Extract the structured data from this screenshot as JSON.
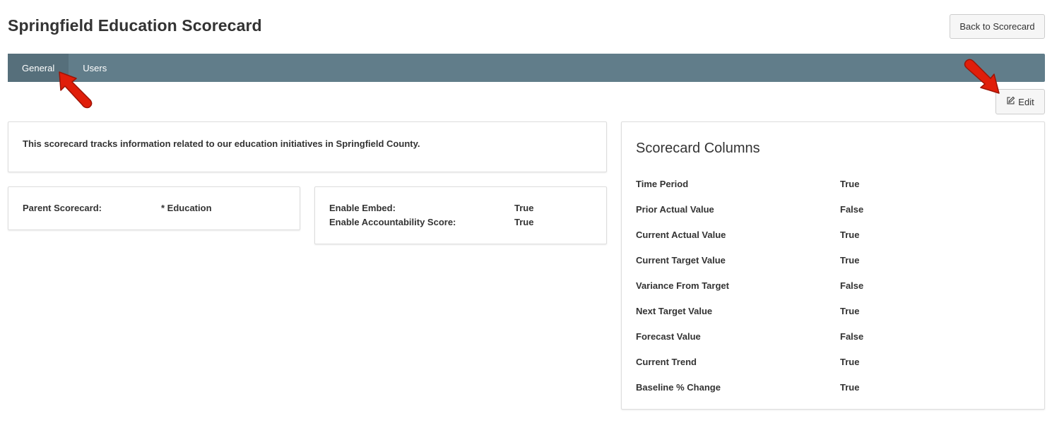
{
  "header": {
    "title": "Springfield Education Scorecard",
    "back_label": "Back to Scorecard"
  },
  "tabs": [
    {
      "label": "General",
      "active": true
    },
    {
      "label": "Users",
      "active": false
    }
  ],
  "toolbar": {
    "edit_label": "Edit",
    "edit_icon": "edit-icon"
  },
  "description": "This scorecard tracks information related to our education initiatives in Springfield County.",
  "parent": {
    "label": "Parent Scorecard:",
    "value": "* Education"
  },
  "settings": [
    {
      "label": "Enable Embed:",
      "value": "True"
    },
    {
      "label": "Enable Accountability Score:",
      "value": "True"
    }
  ],
  "columns_panel": {
    "title": "Scorecard Columns",
    "rows": [
      {
        "label": "Time Period",
        "value": "True"
      },
      {
        "label": "Prior Actual Value",
        "value": "False"
      },
      {
        "label": "Current Actual Value",
        "value": "True"
      },
      {
        "label": "Current Target Value",
        "value": "True"
      },
      {
        "label": "Variance From Target",
        "value": "False"
      },
      {
        "label": "Next Target Value",
        "value": "True"
      },
      {
        "label": "Forecast Value",
        "value": "False"
      },
      {
        "label": "Current Trend",
        "value": "True"
      },
      {
        "label": "Baseline % Change",
        "value": "True"
      }
    ]
  },
  "colors": {
    "tabbar": "#617d8a",
    "tab_active": "#566f7b",
    "annotation_arrow": "#e01e0a"
  }
}
